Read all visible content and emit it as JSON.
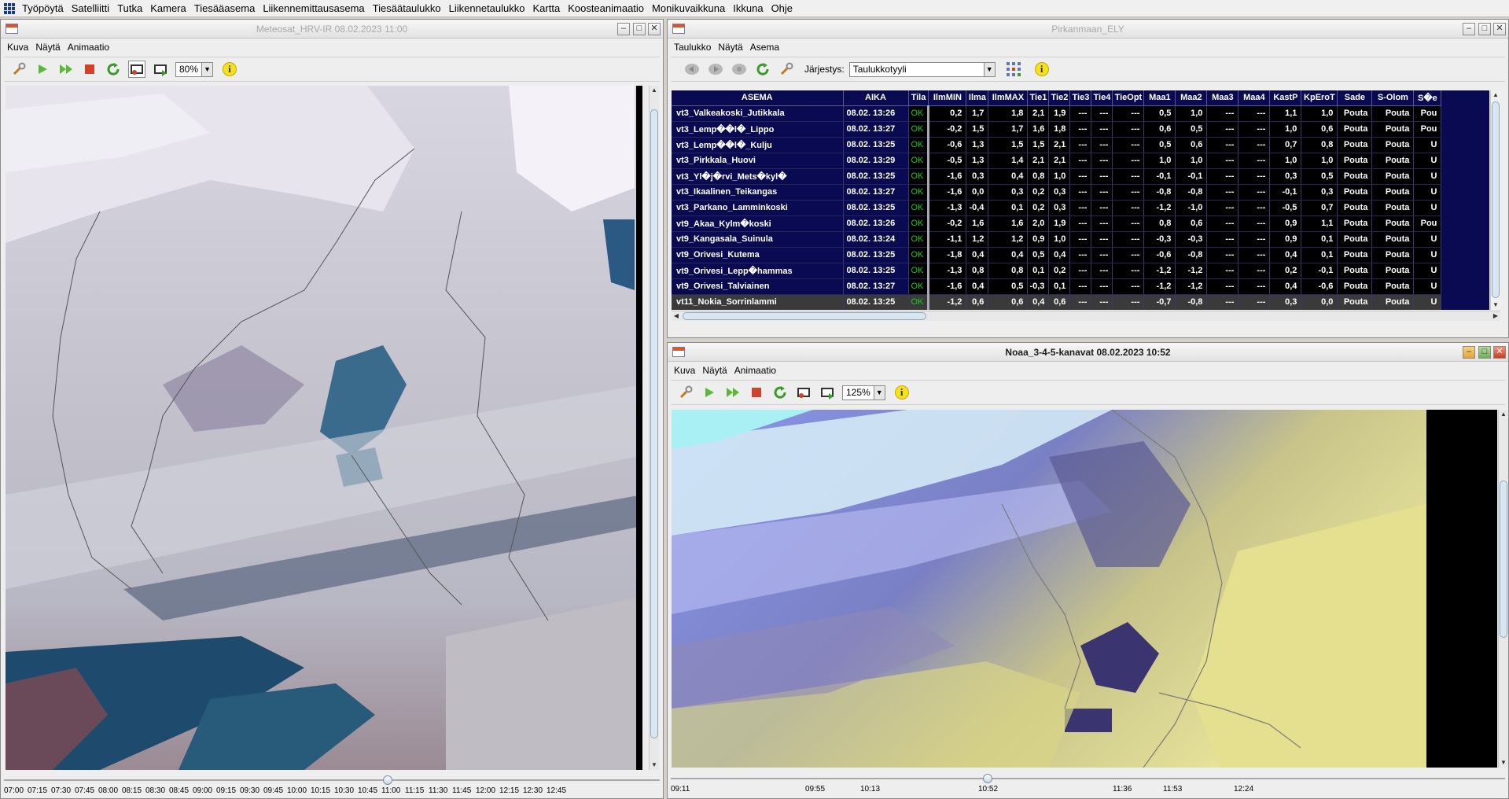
{
  "menubar": {
    "items": [
      "Työpöytä",
      "Satelliitti",
      "Tutka",
      "Kamera",
      "Tiesääasema",
      "Liikennemittausasema",
      "Tiesäätaulukko",
      "Liikennetaulukko",
      "Kartta",
      "Koosteanimaatio",
      "Monikuvaikkuna",
      "Ikkuna",
      "Ohje"
    ]
  },
  "window_left": {
    "title": "Meteosat_HRV-IR 08.02.2023  11:00",
    "menu": [
      "Kuva",
      "Näytä",
      "Animaatio"
    ],
    "zoom": "80%",
    "timeline_labels": [
      "07:00",
      "07:15",
      "07:30",
      "07:45",
      "08:00",
      "08:15",
      "08:30",
      "08:45",
      "09:00",
      "09:15",
      "09:30",
      "09:45",
      "10:00",
      "10:15",
      "10:30",
      "10:45",
      "11:00",
      "11:15",
      "11:30",
      "11:45",
      "12:00",
      "12:15",
      "12:30",
      "12:45"
    ],
    "timeline_position": "11:00"
  },
  "window_table": {
    "title": "Pirkanmaan_ELY",
    "menu": [
      "Taulukko",
      "Näytä",
      "Asema"
    ],
    "sort_label": "Järjestys:",
    "sort_value": "Taulukkotyyli",
    "columns": [
      "ASEMA",
      "AIKA",
      "Tila",
      "IlmMIN",
      "Ilma",
      "IlmMAX",
      "Tie1",
      "Tie2",
      "Tie3",
      "Tie4",
      "TieOpt",
      "Maa1",
      "Maa2",
      "Maa3",
      "Maa4",
      "KastP",
      "KpEroT",
      "Sade",
      "S-Olom",
      "S�e"
    ],
    "rows": [
      [
        "vt3_Valkeakoski_Jutikkala",
        "08.02. 13:26",
        "OK",
        "0,2",
        "1,7",
        "1,8",
        "2,1",
        "1,9",
        "---",
        "---",
        "---",
        "0,5",
        "1,0",
        "---",
        "---",
        "1,1",
        "1,0",
        "Pouta",
        "Pouta",
        "Pou"
      ],
      [
        "vt3_Lemp��l�_Lippo",
        "08.02. 13:27",
        "OK",
        "-0,2",
        "1,5",
        "1,7",
        "1,6",
        "1,8",
        "---",
        "---",
        "---",
        "0,6",
        "0,5",
        "---",
        "---",
        "1,0",
        "0,6",
        "Pouta",
        "Pouta",
        "Pou"
      ],
      [
        "vt3_Lemp��l�_Kulju",
        "08.02. 13:25",
        "OK",
        "-0,6",
        "1,3",
        "1,5",
        "1,5",
        "2,1",
        "---",
        "---",
        "---",
        "0,5",
        "0,6",
        "---",
        "---",
        "0,7",
        "0,8",
        "Pouta",
        "Pouta",
        "U"
      ],
      [
        "vt3_Pirkkala_Huovi",
        "08.02. 13:29",
        "OK",
        "-0,5",
        "1,3",
        "1,4",
        "2,1",
        "2,1",
        "---",
        "---",
        "---",
        "1,0",
        "1,0",
        "---",
        "---",
        "1,0",
        "1,0",
        "Pouta",
        "Pouta",
        "U"
      ],
      [
        "vt3_Yl�j�rvi_Mets�kyl�",
        "08.02. 13:25",
        "OK",
        "-1,6",
        "0,3",
        "0,4",
        "0,8",
        "1,0",
        "---",
        "---",
        "---",
        "-0,1",
        "-0,1",
        "---",
        "---",
        "0,3",
        "0,5",
        "Pouta",
        "Pouta",
        "U"
      ],
      [
        "vt3_Ikaalinen_Teikangas",
        "08.02. 13:27",
        "OK",
        "-1,6",
        "0,0",
        "0,3",
        "0,2",
        "0,3",
        "---",
        "---",
        "---",
        "-0,8",
        "-0,8",
        "---",
        "---",
        "-0,1",
        "0,3",
        "Pouta",
        "Pouta",
        "U"
      ],
      [
        "vt3_Parkano_Lamminkoski",
        "08.02. 13:25",
        "OK",
        "-1,3",
        "-0,4",
        "0,1",
        "0,2",
        "0,3",
        "---",
        "---",
        "---",
        "-1,2",
        "-1,0",
        "---",
        "---",
        "-0,5",
        "0,7",
        "Pouta",
        "Pouta",
        "U"
      ],
      [
        "vt9_Akaa_Kylm�koski",
        "08.02. 13:26",
        "OK",
        "-0,2",
        "1,6",
        "1,6",
        "2,0",
        "1,9",
        "---",
        "---",
        "---",
        "0,8",
        "0,6",
        "---",
        "---",
        "0,9",
        "1,1",
        "Pouta",
        "Pouta",
        "Pou"
      ],
      [
        "vt9_Kangasala_Suinula",
        "08.02. 13:24",
        "OK",
        "-1,1",
        "1,2",
        "1,2",
        "0,9",
        "1,0",
        "---",
        "---",
        "---",
        "-0,3",
        "-0,3",
        "---",
        "---",
        "0,9",
        "0,1",
        "Pouta",
        "Pouta",
        "U"
      ],
      [
        "vt9_Orivesi_Kutema",
        "08.02. 13:25",
        "OK",
        "-1,8",
        "0,4",
        "0,4",
        "0,5",
        "0,4",
        "---",
        "---",
        "---",
        "-0,6",
        "-0,8",
        "---",
        "---",
        "0,4",
        "0,1",
        "Pouta",
        "Pouta",
        "U"
      ],
      [
        "vt9_Orivesi_Lepp�hammas",
        "08.02. 13:25",
        "OK",
        "-1,3",
        "0,8",
        "0,8",
        "0,1",
        "0,2",
        "---",
        "---",
        "---",
        "-1,2",
        "-1,2",
        "---",
        "---",
        "0,2",
        "-0,1",
        "Pouta",
        "Pouta",
        "U"
      ],
      [
        "vt9_Orivesi_Talviainen",
        "08.02. 13:27",
        "OK",
        "-1,6",
        "0,4",
        "0,5",
        "-0,3",
        "0,1",
        "---",
        "---",
        "---",
        "-1,2",
        "-1,2",
        "---",
        "---",
        "0,4",
        "-0,6",
        "Pouta",
        "Pouta",
        "U"
      ],
      [
        "vt11_Nokia_Sorrinlammi",
        "08.02. 13:25",
        "OK",
        "-1,2",
        "0,6",
        "0,6",
        "0,4",
        "0,6",
        "---",
        "---",
        "---",
        "-0,7",
        "-0,8",
        "---",
        "---",
        "0,3",
        "0,0",
        "Pouta",
        "Pouta",
        "U"
      ]
    ],
    "selected_row": 12
  },
  "window_noaa": {
    "title": "Noaa_3-4-5-kanavat 08.02.2023  10:52",
    "menu": [
      "Kuva",
      "Näytä",
      "Animaatio"
    ],
    "zoom": "125%",
    "timeline_labels": [
      "09:11",
      "09:55",
      "10:13",
      "10:52",
      "11:36",
      "11:53",
      "12:24"
    ],
    "timeline_position": "10:52"
  },
  "colors": {
    "table_bg": "#0a0a52",
    "ok_green": "#1ec81e",
    "neg_blue": "#3a9bdc",
    "pos_green": "#7ee87e",
    "yellow": "#f0e040",
    "red": "#ff4848"
  }
}
